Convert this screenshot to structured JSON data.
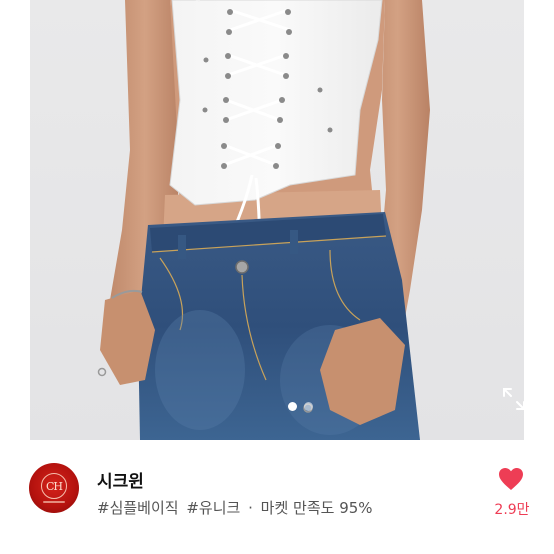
{
  "product": {
    "image_alt_icon": "product-photo-corset-top-and-jeans",
    "gallery": {
      "total_dots": 2,
      "active_index": 0
    },
    "expand_icon": "expand-icon"
  },
  "shop": {
    "name": "시크윈",
    "logo_icon": "shop-logo-icon",
    "logo_letters": "CH",
    "tags": [
      "#심플베이직",
      "#유니크"
    ],
    "separator": "·",
    "satisfaction_label": "마켓 만족도 95%"
  },
  "like": {
    "icon": "heart-icon",
    "count": "2.9만",
    "color": "#ee3d55"
  },
  "colors": {
    "logo_red": "#c0160f",
    "like_red": "#ee3d55",
    "tag_gray": "#555555",
    "name_black": "#111111"
  }
}
